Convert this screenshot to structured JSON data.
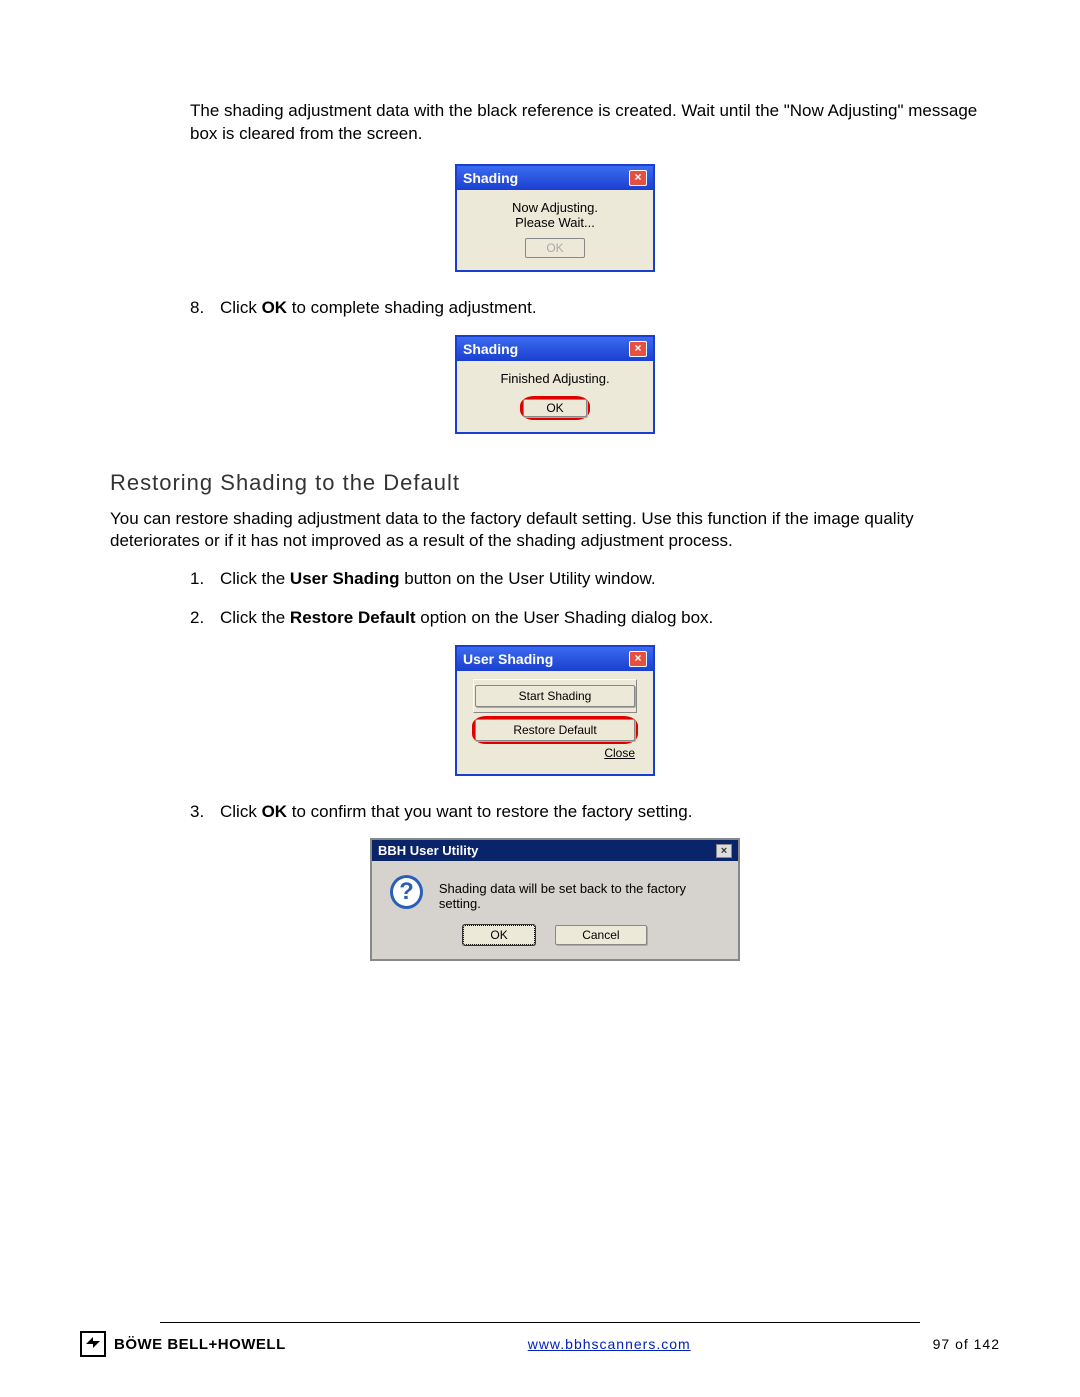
{
  "intro": "The shading adjustment data with the black reference is created. Wait until the \"Now Adjusting\" message box is cleared from the screen.",
  "shading_dialog1": {
    "title": "Shading",
    "line1": "Now Adjusting.",
    "line2": "Please Wait...",
    "ok": "OK"
  },
  "step8_prefix": "Click ",
  "step8_bold": "OK",
  "step8_suffix": " to complete shading adjustment.",
  "shading_dialog2": {
    "title": "Shading",
    "line1": "Finished Adjusting.",
    "ok": "OK"
  },
  "section_heading": "Restoring Shading to the Default",
  "section_intro": "You can restore shading adjustment data to the factory default setting. Use this function if the image quality deteriorates or if it has not improved as a result of the shading adjustment process.",
  "step1_prefix": "Click the ",
  "step1_bold": "User Shading",
  "step1_suffix": " button on the User Utility window.",
  "step2_prefix": "Click the ",
  "step2_bold": "Restore Default",
  "step2_suffix": " option on the User Shading dialog box.",
  "user_shading_dialog": {
    "title": "User Shading",
    "start": "Start Shading",
    "restore": "Restore Default",
    "close": "Close"
  },
  "step3_prefix": "Click ",
  "step3_bold": "OK",
  "step3_suffix": " to confirm that you want to restore the factory setting.",
  "confirm_dialog": {
    "title": "BBH User Utility",
    "message": "Shading data will be set back to the factory setting.",
    "ok": "OK",
    "cancel": "Cancel"
  },
  "footer": {
    "brand": "BÖWE BELL+HOWELL",
    "url": "www.bbhscanners.com",
    "page": "97 of 142"
  }
}
